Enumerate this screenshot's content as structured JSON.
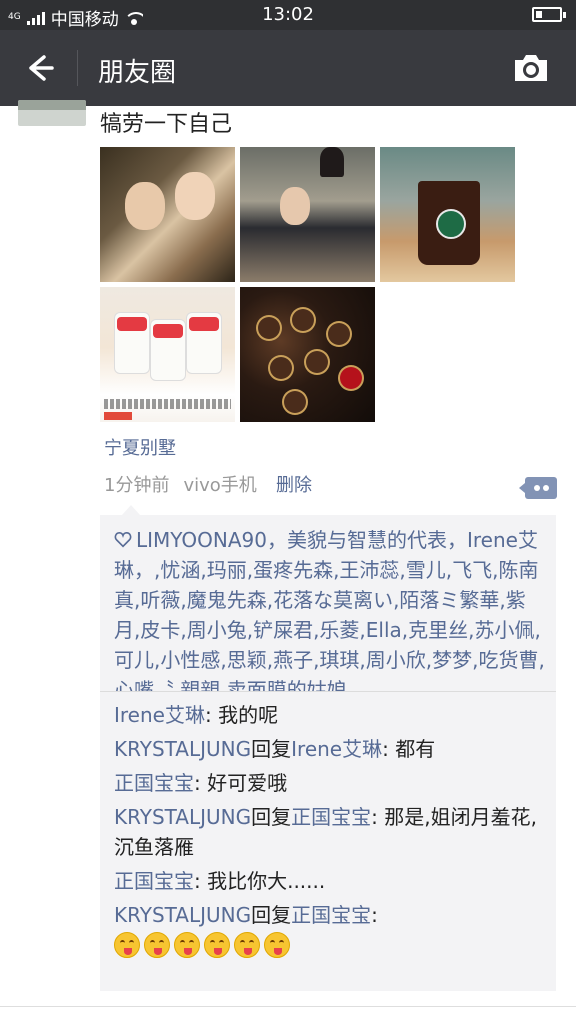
{
  "status_bar": {
    "network_type": "4G",
    "carrier": "中国移动",
    "time": "13:02"
  },
  "navbar": {
    "title": "朋友圈",
    "back_icon": "arrow-left-icon",
    "camera_icon": "camera-icon"
  },
  "post": {
    "text": "犒劳一下自己",
    "photos": [
      {
        "description": "two-girls-selfie"
      },
      {
        "description": "girl-with-guard-statue"
      },
      {
        "description": "starbucks-iced-coffee"
      },
      {
        "description": "yogurt-cups-with-fruit"
      },
      {
        "description": "chocolate-box"
      }
    ],
    "location": "宁夏别墅",
    "time_ago": "1分钟前",
    "device": "vivo手机",
    "delete_label": "删除",
    "accent_color": "#576b95"
  },
  "likes": {
    "icon": "heart-outline-icon",
    "text": "LIMYOONA90，美貌与智慧的代表，Irene艾琳，,忧涵,玛丽,蛋疼先森,王沛蕊,雪儿,飞飞,陈南真,听薇,魔鬼先森,花落な莫离い,陌落ミ繁華,紫月,皮卡,周小兔,铲屎君,乐菱,Ella,克里丝,苏小佩,可儿,小性感,思颖,燕子,琪琪,周小欣,梦梦,吃货曹,心嘴〝 親親,卖面膜的姑娘"
  },
  "comments": [
    {
      "from": "Irene艾琳",
      "reply_word": "",
      "to": "",
      "text": ": 我的呢"
    },
    {
      "from": "KRYSTALJUNG",
      "reply_word": "回复",
      "to": "Irene艾琳",
      "text": ": 都有"
    },
    {
      "from": "正国宝宝",
      "reply_word": "",
      "to": "",
      "text": ": 好可爱哦"
    },
    {
      "from": "KRYSTALJUNG",
      "reply_word": "回复",
      "to": "正国宝宝",
      "text": ": 那是,姐闭月羞花,沉鱼落雁"
    },
    {
      "from": "正国宝宝",
      "reply_word": "",
      "to": "",
      "text": ": 我比你大......"
    },
    {
      "from": "KRYSTALJUNG",
      "reply_word": "回复",
      "to": "正国宝宝",
      "text": ":",
      "emojis": [
        "tongue-wink-emoji",
        "tongue-wink-emoji",
        "tongue-wink-emoji",
        "squint-tongue-emoji",
        "squint-tongue-emoji",
        "squint-tongue-emoji"
      ]
    }
  ]
}
